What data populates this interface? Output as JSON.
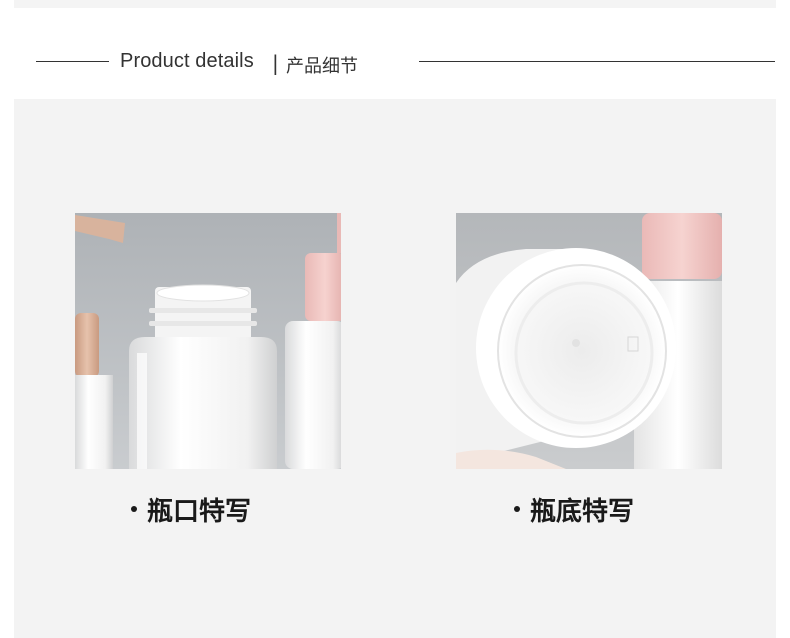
{
  "header": {
    "title_en": "Product details",
    "separator": "|",
    "title_cn": "产品细节"
  },
  "sections": [
    {
      "caption": "瓶口特写",
      "image": "bottle-neck-closeup-photo"
    },
    {
      "caption": "瓶底特写",
      "image": "bottle-bottom-closeup-photo"
    }
  ],
  "colors": {
    "panel_background": "#f3f3f3",
    "cap_pink": "#f3c9c6",
    "cap_beige": "#dcb39a",
    "bottle_white": "#f6f6f6"
  }
}
